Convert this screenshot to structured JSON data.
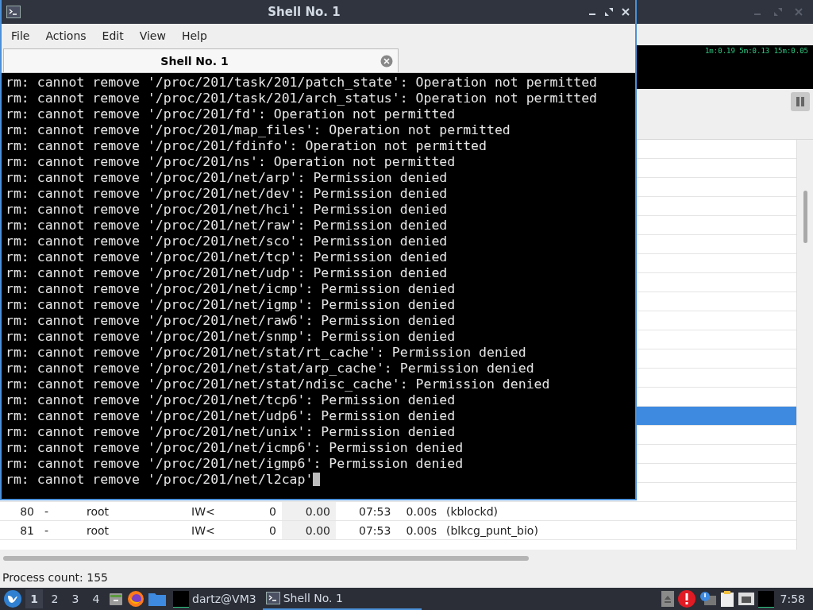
{
  "terminal": {
    "title": "Shell No. 1",
    "menu": [
      "File",
      "Actions",
      "Edit",
      "View",
      "Help"
    ],
    "tabs": [
      {
        "label": "Shell No. 1",
        "selected": true
      }
    ],
    "lines": [
      "rm: cannot remove '/proc/201/task/201/patch_state': Operation not permitted",
      "rm: cannot remove '/proc/201/task/201/arch_status': Operation not permitted",
      "rm: cannot remove '/proc/201/fd': Operation not permitted",
      "rm: cannot remove '/proc/201/map_files': Operation not permitted",
      "rm: cannot remove '/proc/201/fdinfo': Operation not permitted",
      "rm: cannot remove '/proc/201/ns': Operation not permitted",
      "rm: cannot remove '/proc/201/net/arp': Permission denied",
      "rm: cannot remove '/proc/201/net/dev': Permission denied",
      "rm: cannot remove '/proc/201/net/hci': Permission denied",
      "rm: cannot remove '/proc/201/net/raw': Permission denied",
      "rm: cannot remove '/proc/201/net/sco': Permission denied",
      "rm: cannot remove '/proc/201/net/tcp': Permission denied",
      "rm: cannot remove '/proc/201/net/udp': Permission denied",
      "rm: cannot remove '/proc/201/net/icmp': Permission denied",
      "rm: cannot remove '/proc/201/net/igmp': Permission denied",
      "rm: cannot remove '/proc/201/net/raw6': Permission denied",
      "rm: cannot remove '/proc/201/net/snmp': Permission denied",
      "rm: cannot remove '/proc/201/net/stat/rt_cache': Permission denied",
      "rm: cannot remove '/proc/201/net/stat/arp_cache': Permission denied",
      "rm: cannot remove '/proc/201/net/stat/ndisc_cache': Permission denied",
      "rm: cannot remove '/proc/201/net/tcp6': Permission denied",
      "rm: cannot remove '/proc/201/net/udp6': Permission denied",
      "rm: cannot remove '/proc/201/net/unix': Permission denied",
      "rm: cannot remove '/proc/201/net/icmp6': Permission denied",
      "rm: cannot remove '/proc/201/net/igmp6': Permission denied",
      "rm: cannot remove '/proc/201/net/l2cap'"
    ],
    "cursor": true
  },
  "process_monitor": {
    "load": "1m:0.19 5m:0.13 15m:0.05",
    "table": {
      "rows": [
        {
          "selected": true
        },
        {
          "selected": false,
          "cells": [
            "80",
            "-",
            "root",
            "IW<",
            "0",
            "0.00",
            "07:53",
            "0.00s",
            "(kblockd)"
          ]
        },
        {
          "selected": false,
          "cells": [
            "81",
            "-",
            "root",
            "IW<",
            "0",
            "0.00",
            "07:53",
            "0.00s",
            "(blkcg_punt_bio)"
          ]
        }
      ]
    },
    "status": "Process count: 155"
  },
  "taskbar": {
    "workspaces": [
      {
        "label": "1",
        "selected": true
      },
      {
        "label": "2",
        "selected": false
      },
      {
        "label": "3",
        "selected": false
      },
      {
        "label": "4",
        "selected": false
      }
    ],
    "tasks": [
      {
        "label": "dartz@VM3",
        "selected": false,
        "kind": "thumbnail"
      },
      {
        "label": "Shell No. 1",
        "selected": true,
        "kind": "terminal"
      }
    ],
    "clock": "7:58"
  }
}
